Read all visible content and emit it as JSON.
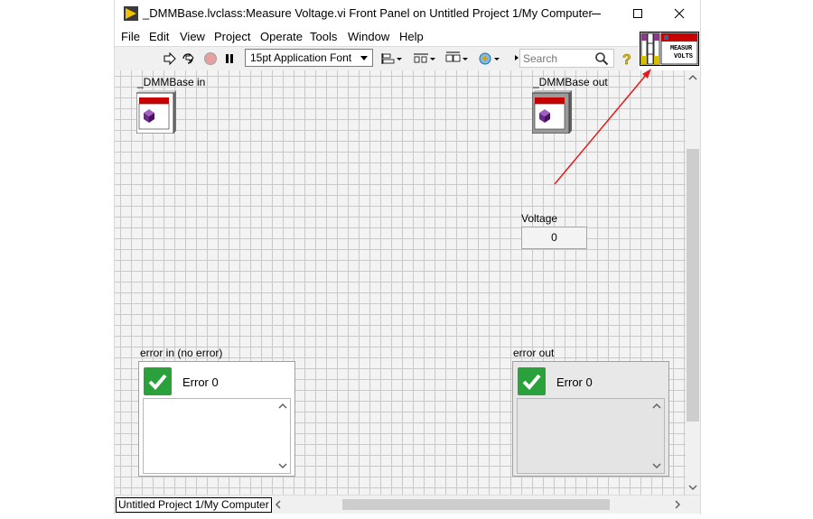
{
  "window": {
    "title": "_DMMBase.lvclass:Measure Voltage.vi Front Panel on Untitled Project 1/My Computer",
    "controls": [
      "minimize",
      "maximize",
      "close"
    ]
  },
  "menu": [
    "File",
    "Edit",
    "View",
    "Project",
    "Operate",
    "Tools",
    "Window",
    "Help"
  ],
  "toolbar": {
    "font": "15pt Application Font",
    "search_placeholder": "Search",
    "icons": [
      "run-arrow-icon",
      "run-continuously-icon",
      "abort-icon",
      "pause-icon",
      "align-objects-icon",
      "distribute-objects-icon",
      "resize-objects-icon",
      "reorder-icon",
      "search-icon",
      "context-help-icon"
    ]
  },
  "connector_pane": {
    "icon_text_line1": "MEASUR",
    "icon_text_line2": "VOLTS"
  },
  "panel": {
    "dmm_in_label": "_DMMBase in",
    "dmm_out_label": "_DMMBase out",
    "voltage_label": "Voltage",
    "voltage_value": "0",
    "error_in_label": "error in (no error)",
    "error_in_code": "Error 0",
    "error_out_label": "error out",
    "error_out_code": "Error 0"
  },
  "statusbar": {
    "context": "Untitled Project 1/My Computer"
  },
  "colors": {
    "accent_green": "#2aa13a",
    "annotation_arrow": "#e21b1b",
    "class_icon_header": "#c80000"
  }
}
